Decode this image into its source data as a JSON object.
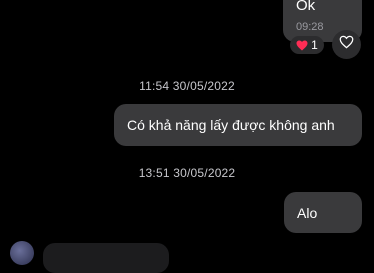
{
  "messages": {
    "ok": {
      "text": "Ok",
      "time": "09:28",
      "reaction_count": "1"
    },
    "question": {
      "text": "Có khả năng lấy được không anh"
    },
    "alo": {
      "text": "Alo"
    }
  },
  "timestamps": {
    "first": "11:54 30/05/2022",
    "second": "13:51 30/05/2022"
  },
  "icons": {
    "reaction": "red-heart-icon",
    "react_button": "heart-outline-icon",
    "avatar": "user-avatar"
  },
  "colors": {
    "background": "#000000",
    "bubble": "#3a3a3c",
    "heart": "#ff2d55"
  }
}
